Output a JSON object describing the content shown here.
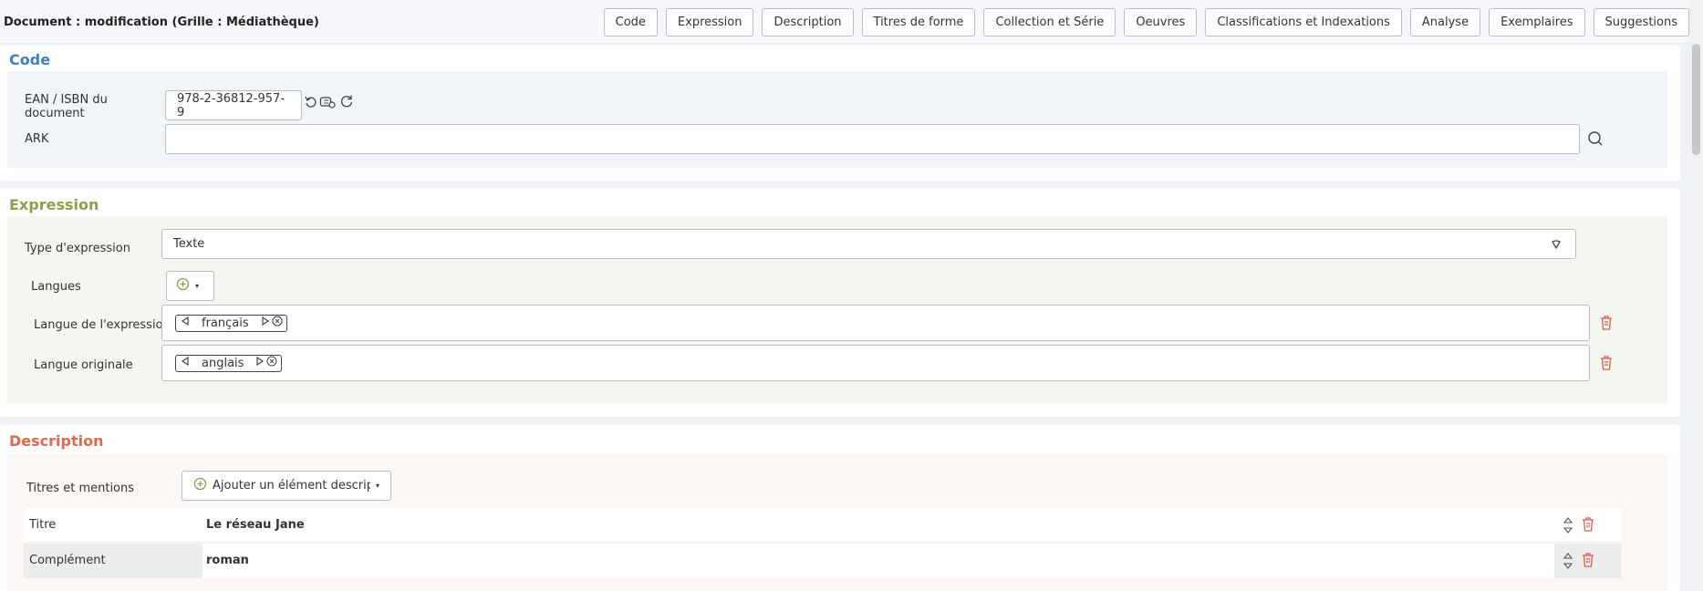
{
  "header": {
    "title": "Document : modification (Grille : Médiathèque)",
    "nav": [
      "Code",
      "Expression",
      "Description",
      "Titres de forme",
      "Collection et Série",
      "Oeuvres",
      "Classifications et Indexations",
      "Analyse",
      "Exemplaires",
      "Suggestions"
    ]
  },
  "code": {
    "heading": "Code",
    "ean_label": "EAN / ISBN du document",
    "ean_value": "978-2-36812-957-9",
    "ark_label": "ARK",
    "ark_value": ""
  },
  "expression": {
    "heading": "Expression",
    "type_label": "Type d'expression",
    "type_value": "Texte",
    "langues_label": "Langues",
    "langue_expression_label": "Langue de l'expression",
    "langue_expression_value": "français",
    "langue_originale_label": "Langue originale",
    "langue_originale_value": "anglais"
  },
  "description": {
    "heading": "Description",
    "titres_label": "Titres et mentions",
    "add_button": "Ajouter un élément descriptif",
    "rows": [
      {
        "label": "Titre",
        "value": "Le réseau Jane"
      },
      {
        "label": "Complément",
        "value": "roman"
      }
    ]
  },
  "colors": {
    "code_heading": "#3f7fc0",
    "expression_heading": "#8aa04a",
    "description_heading": "#e0684e",
    "code_bg": "#f1f4f8",
    "expression_bg": "#f3f7ef",
    "description_bg": "#fcf6f4",
    "trash": "#e05a4a"
  }
}
